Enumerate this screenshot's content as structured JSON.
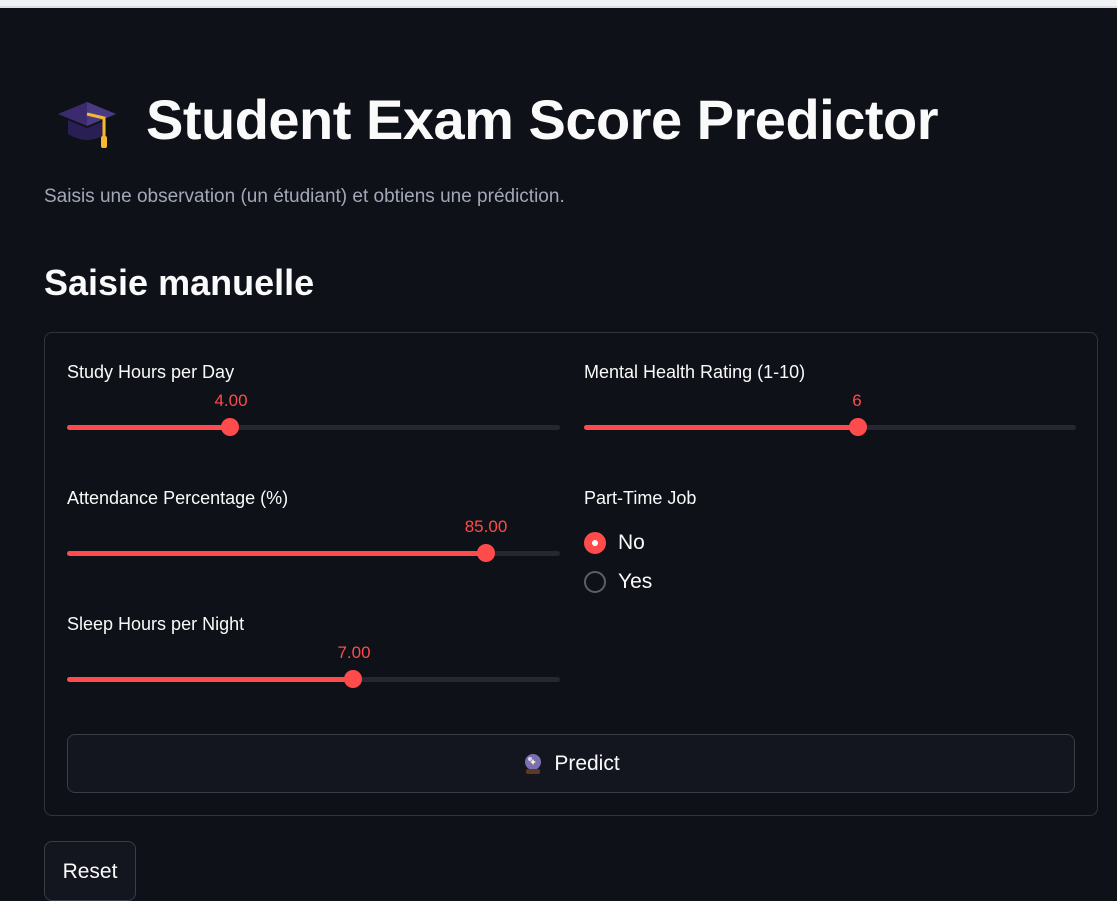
{
  "header": {
    "icon": "graduation-cap-icon",
    "title": "Student Exam Score Predictor",
    "subtitle": "Saisis une observation (un étudiant) et obtiens une prédiction."
  },
  "section": {
    "title": "Saisie manuelle"
  },
  "form": {
    "study_hours": {
      "label": "Study Hours per Day",
      "value": "4.00",
      "level": 0.33
    },
    "attendance": {
      "label": "Attendance Percentage (%)",
      "value": "85.00",
      "level": 0.85
    },
    "sleep_hours": {
      "label": "Sleep Hours per Night",
      "value": "7.00",
      "level": 0.58
    },
    "mental_health": {
      "label": "Mental Health Rating (1-10)",
      "value": "6",
      "level": 0.556
    },
    "part_time_job": {
      "label": "Part-Time Job",
      "options": [
        "No",
        "Yes"
      ],
      "selected": "No"
    }
  },
  "buttons": {
    "predict_icon": "crystal-ball-icon",
    "predict": "Predict",
    "reset": "Reset"
  },
  "colors": {
    "accent": "#ff4b4b",
    "background": "#0e1117",
    "track": "#262730"
  }
}
